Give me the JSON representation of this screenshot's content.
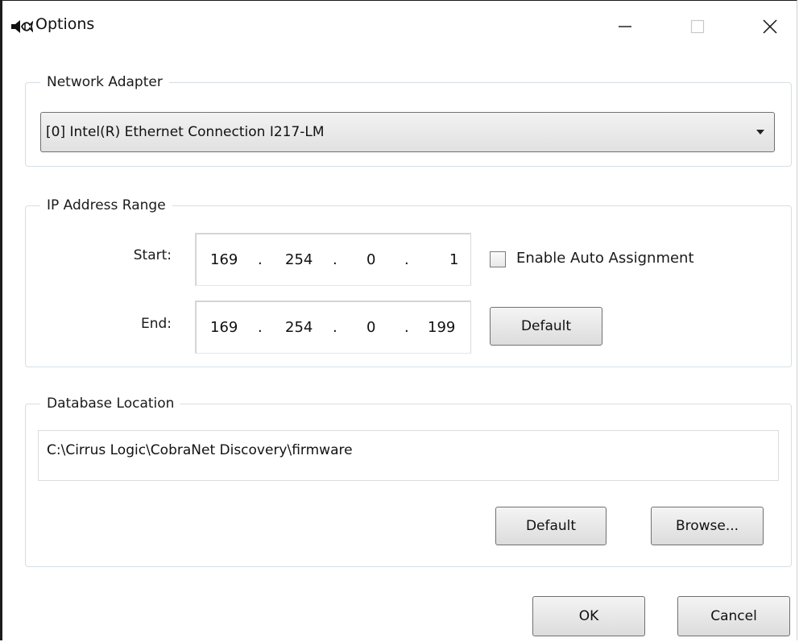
{
  "window": {
    "title": "Options",
    "controls": {
      "minimize": "—",
      "maximize": "☐",
      "close": "✕"
    }
  },
  "network_adapter": {
    "legend": "Network Adapter",
    "selected": "[0] Intel(R) Ethernet Connection I217-LM"
  },
  "ip_range": {
    "legend": "IP Address Range",
    "start_label": "Start:",
    "end_label": "End:",
    "start": [
      "169",
      "254",
      "0",
      "1"
    ],
    "end": [
      "169",
      "254",
      "0",
      "199"
    ],
    "separator": ".",
    "auto_assign_label": "Enable Auto Assignment",
    "auto_assign_checked": false,
    "default_label": "Default"
  },
  "database": {
    "legend": "Database Location",
    "path": "C:\\Cirrus Logic\\CobraNet Discovery\\firmware",
    "default_label": "Default",
    "browse_label": "Browse..."
  },
  "footer": {
    "ok_label": "OK",
    "cancel_label": "Cancel"
  },
  "colors": {
    "group_border": "#d5dfe5",
    "button_border": "#707070"
  }
}
